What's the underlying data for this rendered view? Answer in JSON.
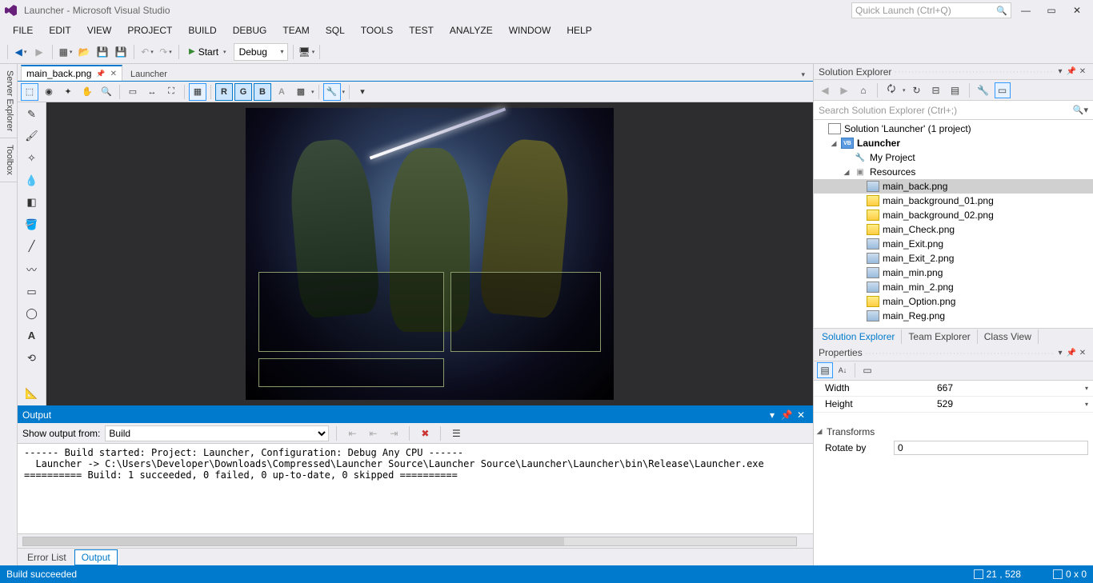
{
  "title": "Launcher - Microsoft Visual Studio",
  "quickLaunch": {
    "placeholder": "Quick Launch (Ctrl+Q)"
  },
  "menu": [
    "FILE",
    "EDIT",
    "VIEW",
    "PROJECT",
    "BUILD",
    "DEBUG",
    "TEAM",
    "SQL",
    "TOOLS",
    "TEST",
    "ANALYZE",
    "WINDOW",
    "HELP"
  ],
  "toolbar": {
    "startLabel": "Start",
    "config": "Debug"
  },
  "leftDock": [
    "Server Explorer",
    "Toolbox"
  ],
  "docTabs": {
    "active": "main_back.png",
    "crumb": "Launcher"
  },
  "solutionExplorer": {
    "title": "Solution Explorer",
    "searchPlaceholder": "Search Solution Explorer (Ctrl+;)",
    "solution": "Solution 'Launcher' (1 project)",
    "project": "Launcher",
    "myProject": "My Project",
    "resources": "Resources",
    "files": [
      {
        "name": "main_back.png",
        "sel": true,
        "y": false
      },
      {
        "name": "main_background_01.png",
        "sel": false,
        "y": true
      },
      {
        "name": "main_background_02.png",
        "sel": false,
        "y": true
      },
      {
        "name": "main_Check.png",
        "sel": false,
        "y": true
      },
      {
        "name": "main_Exit.png",
        "sel": false,
        "y": false
      },
      {
        "name": "main_Exit_2.png",
        "sel": false,
        "y": false
      },
      {
        "name": "main_min.png",
        "sel": false,
        "y": false
      },
      {
        "name": "main_min_2.png",
        "sel": false,
        "y": false
      },
      {
        "name": "main_Option.png",
        "sel": false,
        "y": true
      },
      {
        "name": "main_Reg.png",
        "sel": false,
        "y": false
      }
    ],
    "tabs": [
      "Solution Explorer",
      "Team Explorer",
      "Class View"
    ]
  },
  "properties": {
    "title": "Properties",
    "rows": [
      {
        "k": "Width",
        "v": "667"
      },
      {
        "k": "Height",
        "v": "529"
      }
    ],
    "transforms": "Transforms",
    "rotateLabel": "Rotate by",
    "rotateValue": "0"
  },
  "output": {
    "title": "Output",
    "showFromLabel": "Show output from:",
    "showFrom": "Build",
    "text": "------ Build started: Project: Launcher, Configuration: Debug Any CPU ------\n  Launcher -> C:\\Users\\Developer\\Downloads\\Compressed\\Launcher Source\\Launcher Source\\Launcher\\Launcher\\bin\\Release\\Launcher.exe\n========== Build: 1 succeeded, 0 failed, 0 up-to-date, 0 skipped ==========",
    "tabs": [
      "Error List",
      "Output"
    ]
  },
  "status": {
    "msg": "Build succeeded",
    "pos": "21 , 528",
    "sel": "0 x 0"
  }
}
